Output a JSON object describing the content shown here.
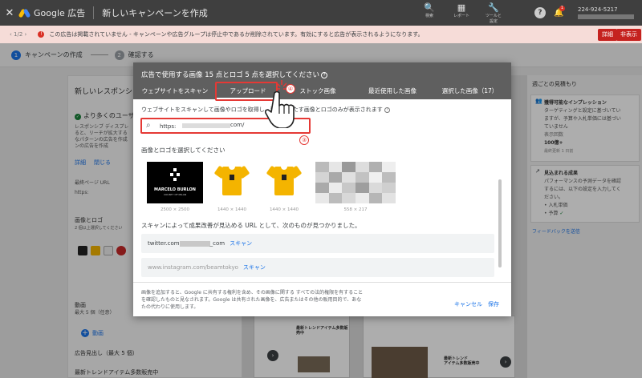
{
  "topbar": {
    "close_icon": "close-icon",
    "brand": "Google 広告",
    "title": "新しいキャンペーンを作成",
    "tools": [
      {
        "icon": "search-icon",
        "label": "検索"
      },
      {
        "icon": "report-icon",
        "label": "レポート"
      },
      {
        "icon": "wrench-icon",
        "label": "ツールと\n設定"
      }
    ],
    "account_id": "224-924-5217",
    "notification_count": "1"
  },
  "error_bar": {
    "nav": "1/2",
    "message": "この広告は掲載されていません - キャンペーンや広告グループは停止中であるか削除されています。有効にすると広告が表示されるようになります。",
    "details_button": "詳細",
    "hide_button": "非表示"
  },
  "stepper": {
    "step1_num": "1",
    "step1_label": "キャンペーンの作成",
    "step2_num": "2",
    "step2_label": "確認する"
  },
  "background_left": {
    "title": "新しいレスポンシブデ",
    "tips_title": "より多くのユーザ",
    "tips_text1": "レスポンシブ ディスプレ",
    "tips_text2": "ると、リーチが拡大する",
    "tips_text3": "なパターンの広告を作成",
    "tips_text4": "ンの広告を作成",
    "details_link": "詳細",
    "close_link": "閉じる",
    "final_url_label": "最終ページ URL",
    "final_url_value": "https:",
    "images_label": "画像とロゴ",
    "images_sub": "2 個以上選択してください",
    "video_label": "動画",
    "video_sub": "最大 5 個（任意）",
    "video_add": "動画",
    "headline_label": "広告見出し（最大 5 個）",
    "headline_value": "最新トレンドアイテム多数販売中"
  },
  "background_right": {
    "title": "週ごとの見積もり",
    "card1_head": "獲得可能なインプレッション",
    "card1_line1": "ターゲティングと設定に基づいてい",
    "card1_line2": "ますが、予算や入札単価には基づい",
    "card1_line3": "ていません",
    "card1_line4": "表示回数",
    "card1_line5": "100億+",
    "card1_line6": "最終更新 1 日前",
    "card2_head": "見込まれる成果",
    "card2_line1": "パフォーマンスの予測データを確認",
    "card2_line2": "するには、以下の設定を入力してく",
    "card2_line3": "ださい。",
    "card2_line4": "入札単価",
    "card2_line5": "予算",
    "feedback_link": "フィードバックを送信"
  },
  "background_center": {
    "ad_text1": "最新トレンドアイテム多数販売中",
    "ad_text2": "最新トレンド\nアイテム多数販売中"
  },
  "modal": {
    "title": "広告で使用する画像 15 点とロゴ 5 点を選択してください",
    "tabs": [
      "ウェブサイトをスキャン",
      "アップロード",
      "ストック画像",
      "最近使用した画像",
      "選択した画像（17）"
    ],
    "annotation_upload": "④",
    "description": "ウェブサイトをスキャンして画像やロゴを取得し、要件を満たす画像とロゴのみが表示されます",
    "url_value": "https:",
    "url_suffix": "com/",
    "annotation_url": "③",
    "select_label": "画像とロゴを選択してください",
    "thumbnails": [
      {
        "kind": "logo",
        "name": "MARCELO BURLON",
        "sub": "COUNTY OF MILAN",
        "dims": "2500 × 2500"
      },
      {
        "kind": "shirt",
        "dims": "1440 × 1440"
      },
      {
        "kind": "shirt",
        "dims": "1440 × 1440"
      },
      {
        "kind": "pixelated",
        "dims": "558 × 217"
      }
    ],
    "scan_result_text": "スキャンによって成果改善が見込める URL として、次のものが見つかりました。",
    "scan_results": [
      {
        "prefix": "twitter.com",
        "suffix": "_com",
        "action": "スキャン"
      },
      {
        "prefix": "www.instagram.com/beamtokyo",
        "suffix": "",
        "action": "スキャン"
      }
    ],
    "legal": "画像を追加すると、Google に共有する権利を含め、その画像に関する すべての法的権限を有することを確認したものと見なされます。Google は共有された画像を、広告またはその他の販用目的で、あなたの代わりに使用します。",
    "cancel": "キャンセル",
    "save": "保存"
  },
  "colors": {
    "accent": "#1a73e8",
    "error": "#d93025",
    "annotation": "#e53935",
    "header": "#3f3f3f"
  }
}
